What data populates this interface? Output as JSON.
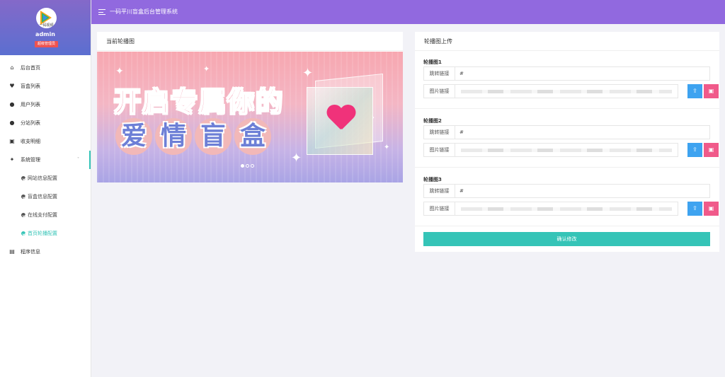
{
  "sidebar": {
    "logo_text": "一码视频",
    "username": "admin",
    "badge": "超级管理员",
    "items": [
      {
        "label": "后台首页",
        "icon": "home-icon"
      },
      {
        "label": "盲盒列表",
        "icon": "heart-icon"
      },
      {
        "label": "用户列表",
        "icon": "user-icon"
      },
      {
        "label": "分站列表",
        "icon": "user-icon"
      },
      {
        "label": "收支明细",
        "icon": "wallet-icon"
      },
      {
        "label": "系统管理",
        "icon": "sparkle-icon"
      }
    ],
    "sub_items": [
      {
        "label": "网站信息配置"
      },
      {
        "label": "盲盒信息配置"
      },
      {
        "label": "在线支付配置"
      },
      {
        "label": "首页轮播配置"
      }
    ],
    "last_item": {
      "label": "程序信息",
      "icon": "terminal-icon"
    }
  },
  "topbar": {
    "title": "一码平川盲盒后台管理系统"
  },
  "left_panel": {
    "title": "当前轮播图",
    "banner": {
      "headline": "开启专属你的",
      "subline": [
        "爱",
        "情",
        "盲",
        "盒"
      ]
    }
  },
  "right_panel": {
    "title": "轮播图上传",
    "groups": [
      {
        "title": "轮播图1",
        "link_label": "跳转链接",
        "link_value": "#",
        "image_label": "图片链接"
      },
      {
        "title": "轮播图2",
        "link_label": "跳转链接",
        "link_value": "#",
        "image_label": "图片链接"
      },
      {
        "title": "轮播图3",
        "link_label": "跳转链接",
        "link_value": "#",
        "image_label": "图片链接"
      }
    ],
    "confirm_label": "确认修改"
  },
  "colors": {
    "topbar": "#9169df",
    "accent": "#35c4b7",
    "upload_button": "#3ea3f0",
    "image_button": "#f05a8a"
  }
}
